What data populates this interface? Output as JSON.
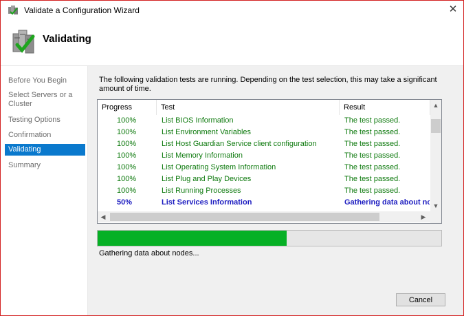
{
  "window": {
    "title": "Validate a Configuration Wizard",
    "close_glyph": "✕"
  },
  "header": {
    "title": "Validating",
    "icon": "server-checkmark-icon"
  },
  "sidebar": {
    "items": [
      {
        "label": "Before You Begin",
        "active": false
      },
      {
        "label": "Select Servers or a Cluster",
        "active": false
      },
      {
        "label": "Testing Options",
        "active": false
      },
      {
        "label": "Confirmation",
        "active": false
      },
      {
        "label": "Validating",
        "active": true
      },
      {
        "label": "Summary",
        "active": false
      }
    ]
  },
  "main": {
    "description": "The following validation tests are running. Depending on the test selection, this may take a significant amount of time.",
    "columns": {
      "progress": "Progress",
      "test": "Test",
      "result": "Result"
    },
    "rows": [
      {
        "progress": "100%",
        "test": "List BIOS Information",
        "result": "The test passed.",
        "state": "passed"
      },
      {
        "progress": "100%",
        "test": "List Environment Variables",
        "result": "The test passed.",
        "state": "passed"
      },
      {
        "progress": "100%",
        "test": "List Host Guardian Service client configuration",
        "result": "The test passed.",
        "state": "passed"
      },
      {
        "progress": "100%",
        "test": "List Memory Information",
        "result": "The test passed.",
        "state": "passed"
      },
      {
        "progress": "100%",
        "test": "List Operating System Information",
        "result": "The test passed.",
        "state": "passed"
      },
      {
        "progress": "100%",
        "test": "List Plug and Play Devices",
        "result": "The test passed.",
        "state": "passed"
      },
      {
        "progress": "100%",
        "test": "List Running Processes",
        "result": "The test passed.",
        "state": "passed"
      },
      {
        "progress": "50%",
        "test": "List Services Information",
        "result": "Gathering data about nodes...",
        "state": "running"
      }
    ],
    "overall_progress": 0.55,
    "status_text": "Gathering data about nodes...",
    "colors": {
      "passed": "#0e7a0e",
      "running": "#1c1cc0",
      "progress_fill": "#06b025",
      "selected": "#0a79cd"
    }
  },
  "footer": {
    "cancel_label": "Cancel"
  }
}
